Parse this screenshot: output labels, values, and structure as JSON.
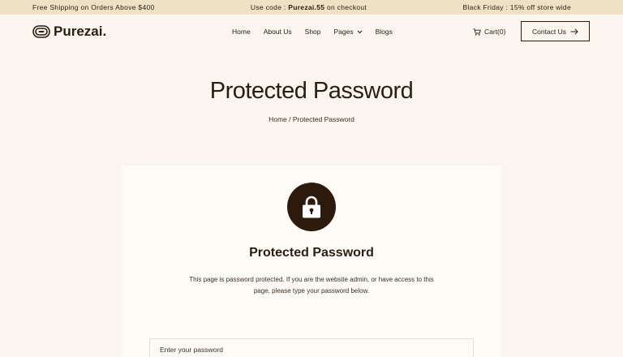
{
  "announcement": {
    "left": "Free Shipping on Orders Above $400",
    "middle_prefix": "Use code :",
    "middle_code": "Purezai.55",
    "middle_suffix": "on checkout",
    "right": "Black Friday : 15% off store wide"
  },
  "header": {
    "logo_text": "Purezai.",
    "nav": [
      {
        "label": "Home"
      },
      {
        "label": "About Us"
      },
      {
        "label": "Shop"
      },
      {
        "label": "Pages"
      },
      {
        "label": "Blogs"
      }
    ],
    "cart_label": "Cart(0)",
    "contact_label": "Contact Us"
  },
  "hero": {
    "title": "Protected Password",
    "breadcrumb": "Home / Protected Password"
  },
  "card": {
    "title": "Protected Password",
    "description": "This page is password protected. If you are the website admin, or have access to this page, please type your password below.",
    "password_placeholder": "Enter your password"
  },
  "colors": {
    "background": "#faf5ee",
    "announcement_bar": "#efe2c4",
    "text": "#2a1d12",
    "lock_circle": "#2c1a0c",
    "card": "#fefbf7"
  },
  "icons": [
    "logo-mark-icon",
    "chevron-down-icon",
    "cart-icon",
    "arrow-right-icon",
    "lock-icon"
  ]
}
